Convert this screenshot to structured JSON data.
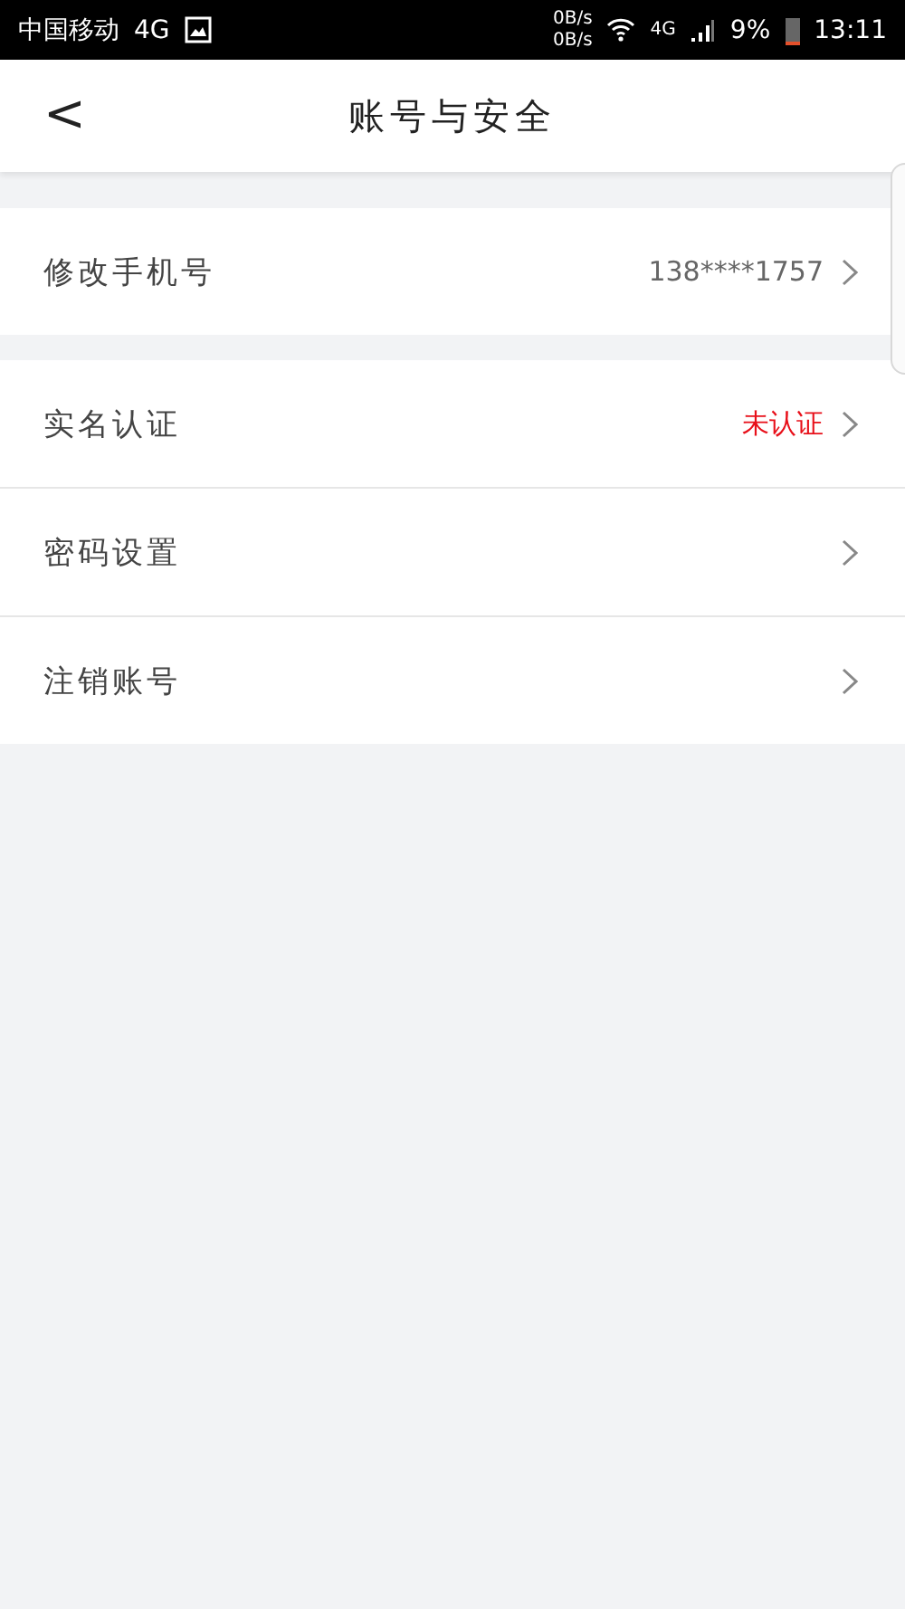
{
  "status_bar": {
    "carrier": "中国移动",
    "carrier_network": "4G",
    "upload_speed": "0B/s",
    "download_speed": "0B/s",
    "network": "4G",
    "battery": "9%",
    "time": "13:11"
  },
  "header": {
    "back": "<",
    "title": "账号与安全"
  },
  "groups": [
    {
      "rows": [
        {
          "label": "修改手机号",
          "value": "138****1757",
          "color": "#666666"
        }
      ]
    },
    {
      "rows": [
        {
          "label": "实名认证",
          "value": "未认证",
          "color": "#e8101a"
        },
        {
          "label": "密码设置"
        },
        {
          "label": "注销账号"
        }
      ]
    }
  ]
}
